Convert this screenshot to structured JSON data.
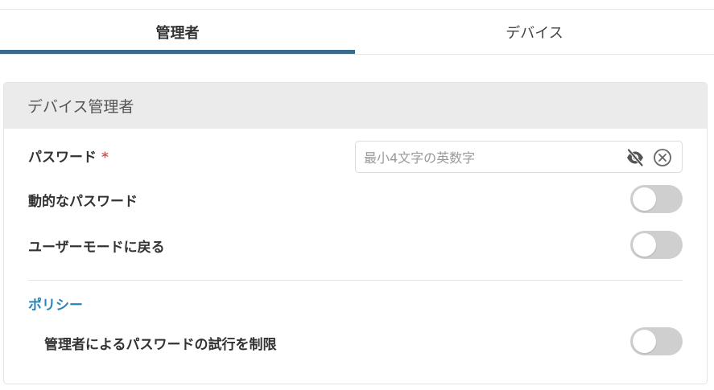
{
  "tabs": [
    {
      "label": "管理者",
      "active": true
    },
    {
      "label": "デバイス",
      "active": false
    }
  ],
  "colors": {
    "accent": "#3b6a8c",
    "section_title": "#2a86b8",
    "required": "#d9534f",
    "toggle_off": "#cfcfcf"
  },
  "card": {
    "title": "デバイス管理者",
    "password": {
      "label": "パスワード",
      "required_mark": "*",
      "value": "",
      "placeholder": "最小4文字の英数字",
      "visibility_icon": "eye-slash-icon",
      "clear_icon": "close-circle-icon"
    },
    "settings": [
      {
        "label": "動的なパスワード",
        "enabled": false
      },
      {
        "label": "ユーザーモードに戻る",
        "enabled": false
      }
    ],
    "policy": {
      "title": "ポリシー",
      "items": [
        {
          "label": "管理者によるパスワードの試行を制限",
          "enabled": false
        }
      ]
    }
  }
}
